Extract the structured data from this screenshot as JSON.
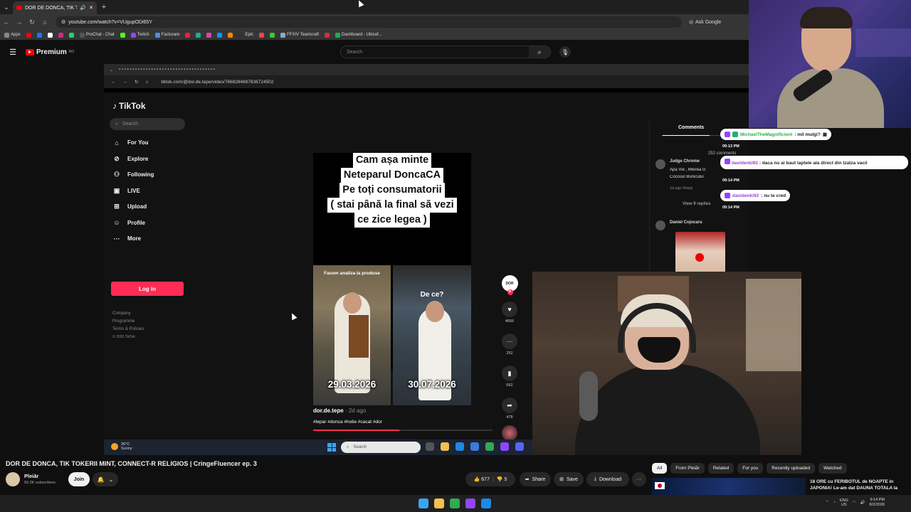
{
  "browser": {
    "tab_title": "DOR DE DONCA, TIK TOKERII",
    "url": "youtube.com/watch?v=VUgupODi65Y",
    "ask_google": "Ask Google",
    "bookmarks": [
      "Apps",
      "ProChat - Chat",
      "Twitch",
      "Facturare",
      "Epic",
      "FFXIV Teamcraft",
      "Dashboard - Ubisof..."
    ]
  },
  "youtube": {
    "logo": "Premium",
    "logo_sup": "RO",
    "search_placeholder": "Search",
    "video_title": "DOR DE DONCA, TIK TOKERII MINT, CONNECT-R RELIGIOS | CringeFluencer ep. 3",
    "channel_name": "Pleiăr",
    "channel_subs": "50.3K subscribers",
    "join_label": "Join",
    "likes": "677",
    "dislikes": "5",
    "share_label": "Share",
    "save_label": "Save",
    "download_label": "Download",
    "chips": [
      "All",
      "From Pleiăr",
      "Related",
      "For you",
      "Recently uploaded",
      "Watched"
    ],
    "rec_title": "18 ORE cu FERIBOTUL de NOAPTE in JAPONIA! Le-am dat DAUNA TOTALA la"
  },
  "video": {
    "inner_url": "tiktok.com/@dor.de.tepe/video/7668284887836724502",
    "tiktok": {
      "logo": "TikTok",
      "search_placeholder": "Search",
      "nav": [
        {
          "icon": "⌂",
          "label": "For You"
        },
        {
          "icon": "⊘",
          "label": "Explore"
        },
        {
          "icon": "⚇",
          "label": "Following"
        },
        {
          "icon": "▣",
          "label": "LIVE"
        },
        {
          "icon": "⊞",
          "label": "Upload"
        },
        {
          "icon": "☺",
          "label": "Profile"
        },
        {
          "icon": "···",
          "label": "More"
        }
      ],
      "login": "Log in",
      "footer": [
        "Company",
        "Programme",
        "Terms & Policies"
      ],
      "copyright": "© 2026 TikTok",
      "caption": [
        "Cam așa minte",
        "Neteparul DoncaCA",
        "Pe toți consumatorii",
        "( stai până la final să vezi",
        "ce zice legea )"
      ],
      "clip_left_label": "Facem analiza la produse",
      "clip_right_label": "De ce?",
      "date_left": "29.03.2026",
      "date_right": "30.07.2026",
      "author": "dor.de.tepe",
      "ago": "· 2d ago",
      "tags": "#tepar #donca #hotie #cacat #dor",
      "progress": 0.48,
      "avatar_text": "DOR",
      "counts": {
        "likes": "4666",
        "comments": "252",
        "saves": "662",
        "shares": "478"
      },
      "comments_tab": "Comments",
      "comment_count": "252 comments",
      "comment1": {
        "name": "Judge Chrome",
        "text": "Apa Vie , Mierea G",
        "text2": "Cocosul Bunicului",
        "meta": "1d ago   Reply",
        "replies": "View 9 replies"
      },
      "comment2": {
        "name": "Daniel Cojocaru"
      }
    },
    "weather": {
      "temp": "26°C",
      "cond": "Sunny"
    },
    "taskbar_search": "Search"
  },
  "chat": [
    {
      "user": "MichaelTheMagnificient",
      "msg": ": mil mulgi?",
      "time": "09:13 PM"
    },
    {
      "user": "davidenki92",
      "msg": ": daca nu ai baut laptele ala direct din tzatza",
      "msg2": "vacii",
      "time": "09:14 PM"
    },
    {
      "user": "davidenki92",
      "msg": ": nu te cred",
      "time": "09:14 PM"
    }
  ],
  "os": {
    "lang1": "ENG",
    "lang2": "US",
    "time": "9:14 PM",
    "date": "8/2/2026"
  }
}
